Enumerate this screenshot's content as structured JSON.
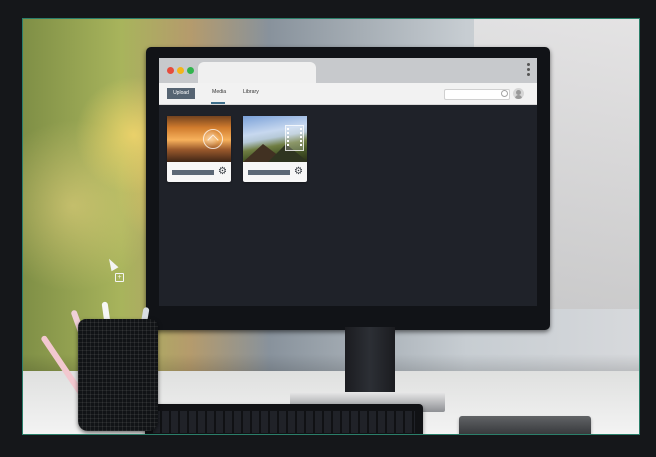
{
  "app": {
    "nav": {
      "upload_label": "Upload",
      "media_label": "Media",
      "library_label": "Library"
    },
    "search": {
      "placeholder": ""
    },
    "icons": {
      "menu": "kebab-menu-icon",
      "search": "search-icon",
      "avatar": "user-avatar-icon",
      "settings": "gear-icon"
    }
  },
  "media_items": [
    {
      "thumbnail": "sunset-landscape",
      "overlay_icon": "cloud-icon"
    },
    {
      "thumbnail": "mountain-landscape",
      "overlay_icon": "film-icon"
    }
  ],
  "colors": {
    "upload_button": "#566472",
    "window_close": "#e64c3c",
    "window_minimize": "#f3b51a",
    "window_maximize": "#32b44d",
    "screen_background": "#1f2229"
  }
}
